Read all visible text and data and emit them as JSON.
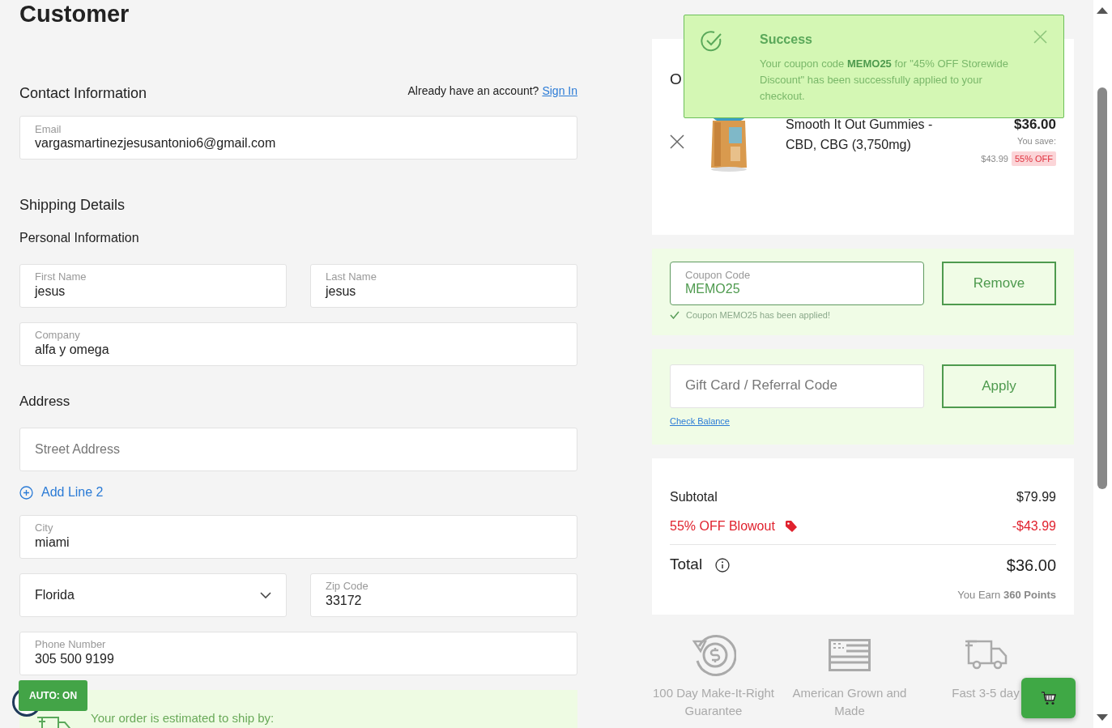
{
  "page_title": "Customer",
  "contact": {
    "heading": "Contact Information",
    "account_prompt": "Already have an account?",
    "sign_in_link": "Sign In",
    "email": {
      "label": "Email",
      "value": "vargasmartinezjesusantonio6@gmail.com"
    }
  },
  "shipping": {
    "heading": "Shipping Details",
    "subheading": "Personal Information",
    "first_name": {
      "label": "First Name",
      "value": "jesus"
    },
    "last_name": {
      "label": "Last Name",
      "value": "jesus"
    },
    "company": {
      "label": "Company",
      "value": "alfa y omega"
    },
    "address_heading": "Address",
    "street": {
      "placeholder": "Street Address"
    },
    "add_line_link": "Add Line 2",
    "city": {
      "label": "City",
      "value": "miami"
    },
    "state": {
      "value": "Florida"
    },
    "zip": {
      "label": "Zip Code",
      "value": "33172"
    },
    "phone": {
      "label": "Phone Number",
      "value": "305 500 9199"
    },
    "ship_estimate": "Your order is estimated to ship by:"
  },
  "auto_badge": "AUTO: ON",
  "order_summary": {
    "heading_visible": "O",
    "items": [
      {
        "name": "Smooth It Out Gummies - CBD, CBG (3,750mg)",
        "price": "$36.00",
        "save_label": "You save:",
        "original_price": "$43.99",
        "discount": "55% OFF"
      }
    ]
  },
  "coupon": {
    "label": "Coupon Code",
    "value": "MEMO25",
    "applied_message": "Coupon MEMO25 has been applied!",
    "button": "Remove"
  },
  "gift_card": {
    "placeholder": "Gift Card / Referral Code",
    "button": "Apply",
    "link": "Check Balance"
  },
  "totals": {
    "subtotal_label": "Subtotal",
    "subtotal": "$79.99",
    "discount_label": "55% OFF Blowout",
    "discount": "-$43.99",
    "total_label": "Total",
    "total": "$36.00",
    "points": "You Earn **360 Points**"
  },
  "features": [
    {
      "kind": "refund",
      "text": "100 Day Make-It-Right Guarantee"
    },
    {
      "kind": "flag",
      "text": "American Grown and Made"
    },
    {
      "kind": "truck",
      "text": "Fast 3-5 day"
    }
  ],
  "toast": {
    "title": "Success",
    "message": "Your coupon code **MEMO25** for \"45% OFF Storewide Discount\" has been successfully applied to your checkout."
  }
}
